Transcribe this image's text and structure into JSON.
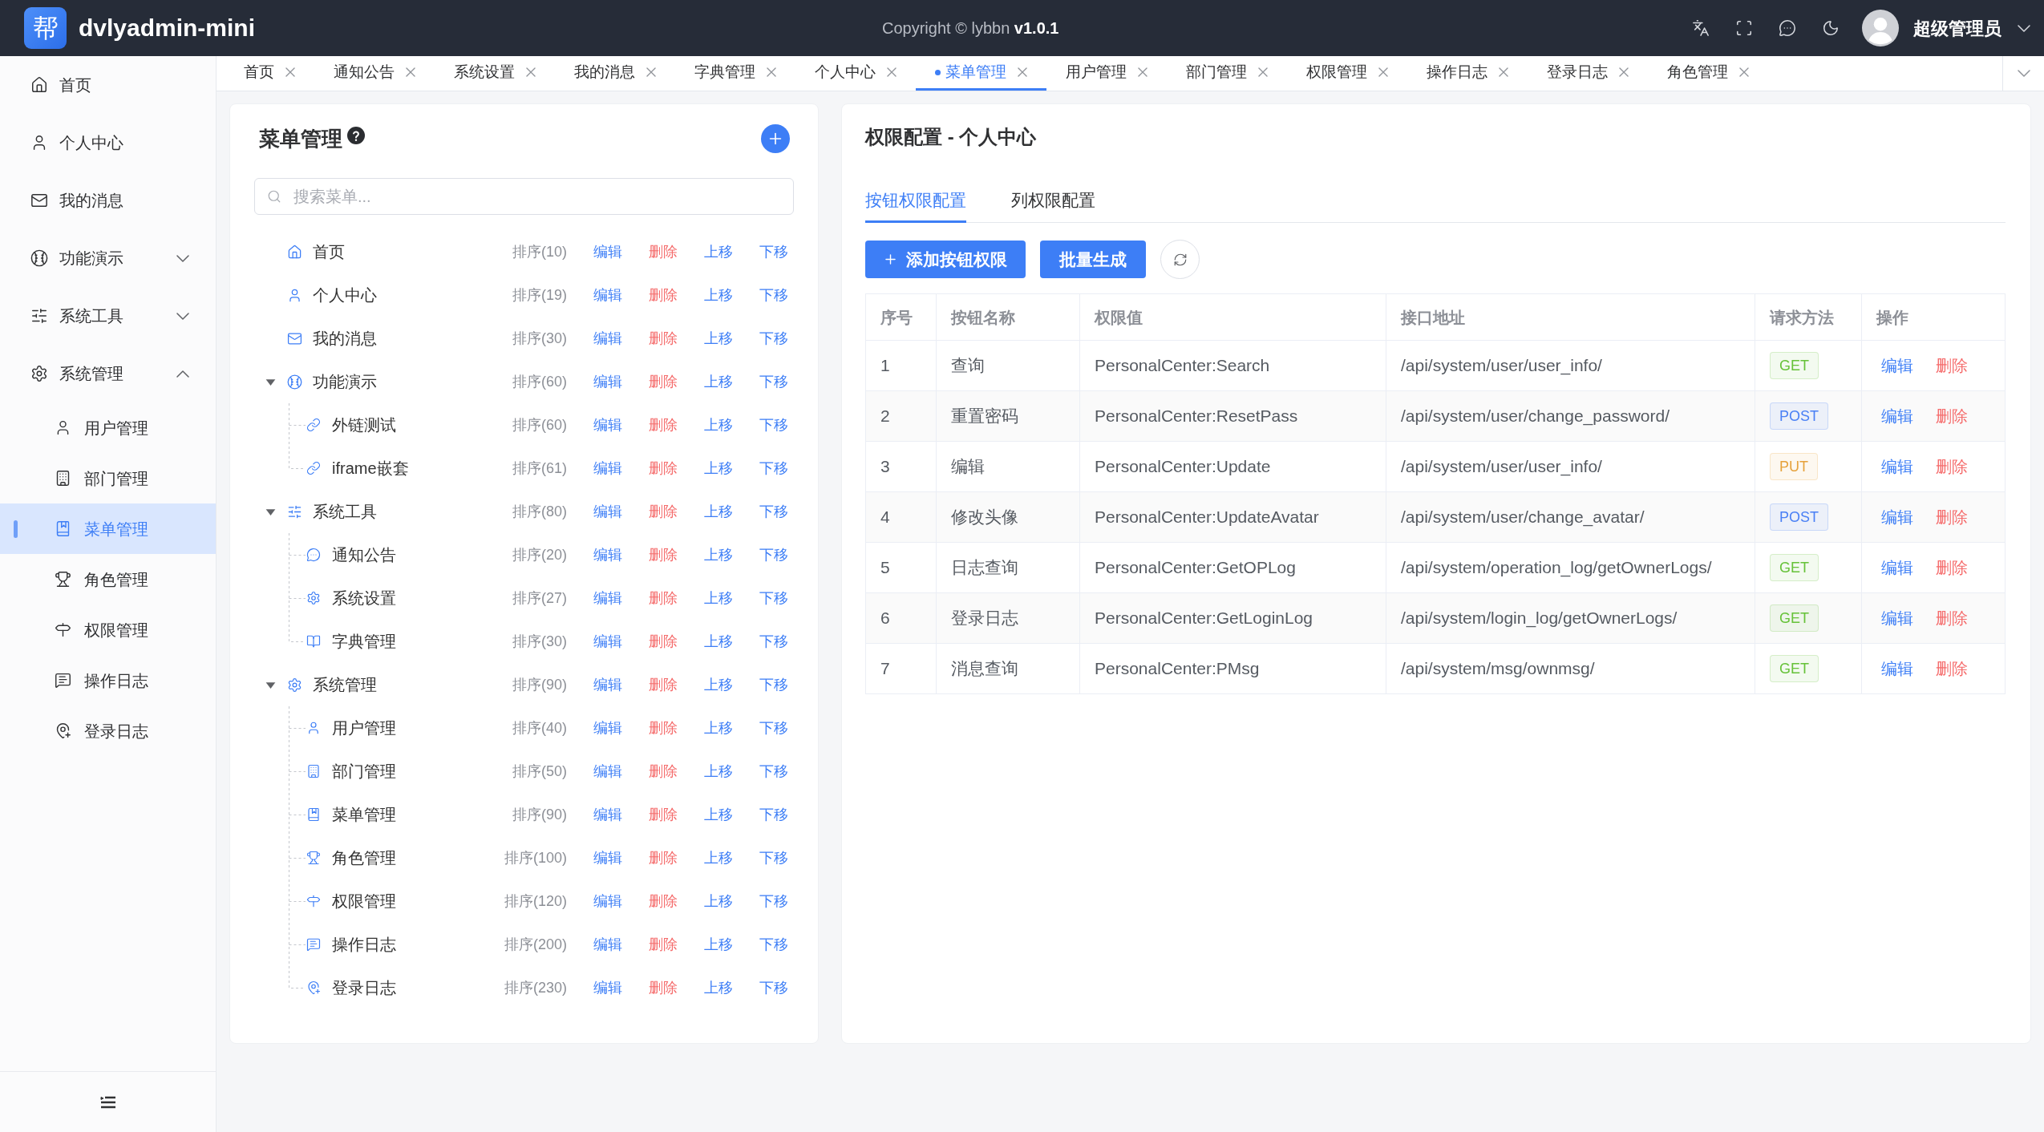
{
  "header": {
    "logo": "帮",
    "title": "dvlyadmin-mini",
    "copyright": "Copyright © lybbn **v1.0.1**",
    "user": "超级管理员"
  },
  "sidebar": {
    "items": [
      {
        "label": "首页",
        "selected": false
      },
      {
        "label": "个人中心",
        "selected": false
      },
      {
        "label": "我的消息",
        "selected": false
      },
      {
        "label": "功能演示",
        "selected": false,
        "expanded": false
      },
      {
        "label": "系统工具",
        "selected": false,
        "expanded": false
      },
      {
        "label": "系统管理",
        "selected": false,
        "expanded": true,
        "children": [
          {
            "label": "用户管理",
            "selected": false
          },
          {
            "label": "部门管理",
            "selected": false
          },
          {
            "label": "菜单管理",
            "selected": true
          },
          {
            "label": "角色管理",
            "selected": false
          },
          {
            "label": "权限管理",
            "selected": false
          },
          {
            "label": "操作日志",
            "selected": false
          },
          {
            "label": "登录日志",
            "selected": false
          }
        ]
      }
    ]
  },
  "tabs": [
    {
      "label": "首页",
      "selected": false
    },
    {
      "label": "通知公告",
      "selected": false
    },
    {
      "label": "系统设置",
      "selected": false
    },
    {
      "label": "我的消息",
      "selected": false
    },
    {
      "label": "字典管理",
      "selected": false
    },
    {
      "label": "个人中心",
      "selected": false
    },
    {
      "label": "菜单管理",
      "selected": true
    },
    {
      "label": "用户管理",
      "selected": false
    },
    {
      "label": "部门管理",
      "selected": false
    },
    {
      "label": "权限管理",
      "selected": false
    },
    {
      "label": "操作日志",
      "selected": false
    },
    {
      "label": "登录日志",
      "selected": false
    },
    {
      "label": "角色管理",
      "selected": false
    }
  ],
  "menu_panel": {
    "title": "菜单管理",
    "search": {
      "placeholder": "搜索菜单..."
    },
    "tree": [
      {
        "label": "首页",
        "sort": "排序(10)",
        "actions": [
          {
            "label": "编辑",
            "kind": "primary"
          },
          {
            "label": "删除",
            "kind": "danger"
          },
          {
            "label": "上移",
            "kind": "primary"
          },
          {
            "label": "下移",
            "kind": "primary"
          }
        ]
      },
      {
        "label": "个人中心",
        "sort": "排序(19)",
        "actions": [
          {
            "label": "编辑",
            "kind": "primary"
          },
          {
            "label": "删除",
            "kind": "danger"
          },
          {
            "label": "上移",
            "kind": "primary"
          },
          {
            "label": "下移",
            "kind": "primary"
          }
        ]
      },
      {
        "label": "我的消息",
        "sort": "排序(30)",
        "actions": [
          {
            "label": "编辑",
            "kind": "primary"
          },
          {
            "label": "删除",
            "kind": "danger"
          },
          {
            "label": "上移",
            "kind": "primary"
          },
          {
            "label": "下移",
            "kind": "primary"
          }
        ]
      },
      {
        "label": "功能演示",
        "sort": "排序(60)",
        "expanded": true,
        "actions": [
          {
            "label": "编辑",
            "kind": "primary"
          },
          {
            "label": "删除",
            "kind": "danger"
          },
          {
            "label": "上移",
            "kind": "primary"
          },
          {
            "label": "下移",
            "kind": "primary"
          }
        ],
        "children": [
          {
            "label": "外链测试",
            "sort": "排序(60)",
            "actions": [
              {
                "label": "编辑",
                "kind": "primary"
              },
              {
                "label": "删除",
                "kind": "danger"
              },
              {
                "label": "上移",
                "kind": "primary"
              },
              {
                "label": "下移",
                "kind": "primary"
              }
            ]
          },
          {
            "label": "iframe嵌套",
            "sort": "排序(61)",
            "actions": [
              {
                "label": "编辑",
                "kind": "primary"
              },
              {
                "label": "删除",
                "kind": "danger"
              },
              {
                "label": "上移",
                "kind": "primary"
              },
              {
                "label": "下移",
                "kind": "primary"
              }
            ]
          }
        ]
      },
      {
        "label": "系统工具",
        "sort": "排序(80)",
        "expanded": true,
        "actions": [
          {
            "label": "编辑",
            "kind": "primary"
          },
          {
            "label": "删除",
            "kind": "danger"
          },
          {
            "label": "上移",
            "kind": "primary"
          },
          {
            "label": "下移",
            "kind": "primary"
          }
        ],
        "children": [
          {
            "label": "通知公告",
            "sort": "排序(20)",
            "actions": [
              {
                "label": "编辑",
                "kind": "primary"
              },
              {
                "label": "删除",
                "kind": "danger"
              },
              {
                "label": "上移",
                "kind": "primary"
              },
              {
                "label": "下移",
                "kind": "primary"
              }
            ]
          },
          {
            "label": "系统设置",
            "sort": "排序(27)",
            "actions": [
              {
                "label": "编辑",
                "kind": "primary"
              },
              {
                "label": "删除",
                "kind": "danger"
              },
              {
                "label": "上移",
                "kind": "primary"
              },
              {
                "label": "下移",
                "kind": "primary"
              }
            ]
          },
          {
            "label": "字典管理",
            "sort": "排序(30)",
            "actions": [
              {
                "label": "编辑",
                "kind": "primary"
              },
              {
                "label": "删除",
                "kind": "danger"
              },
              {
                "label": "上移",
                "kind": "primary"
              },
              {
                "label": "下移",
                "kind": "primary"
              }
            ]
          }
        ]
      },
      {
        "label": "系统管理",
        "sort": "排序(90)",
        "expanded": true,
        "actions": [
          {
            "label": "编辑",
            "kind": "primary"
          },
          {
            "label": "删除",
            "kind": "danger"
          },
          {
            "label": "上移",
            "kind": "primary"
          },
          {
            "label": "下移",
            "kind": "primary"
          }
        ],
        "children": [
          {
            "label": "用户管理",
            "sort": "排序(40)",
            "actions": [
              {
                "label": "编辑",
                "kind": "primary"
              },
              {
                "label": "删除",
                "kind": "danger"
              },
              {
                "label": "上移",
                "kind": "primary"
              },
              {
                "label": "下移",
                "kind": "primary"
              }
            ]
          },
          {
            "label": "部门管理",
            "sort": "排序(50)",
            "actions": [
              {
                "label": "编辑",
                "kind": "primary"
              },
              {
                "label": "删除",
                "kind": "danger"
              },
              {
                "label": "上移",
                "kind": "primary"
              },
              {
                "label": "下移",
                "kind": "primary"
              }
            ]
          },
          {
            "label": "菜单管理",
            "sort": "排序(90)",
            "actions": [
              {
                "label": "编辑",
                "kind": "primary"
              },
              {
                "label": "删除",
                "kind": "danger"
              },
              {
                "label": "上移",
                "kind": "primary"
              },
              {
                "label": "下移",
                "kind": "primary"
              }
            ]
          },
          {
            "label": "角色管理",
            "sort": "排序(100)",
            "actions": [
              {
                "label": "编辑",
                "kind": "primary"
              },
              {
                "label": "删除",
                "kind": "danger"
              },
              {
                "label": "上移",
                "kind": "primary"
              },
              {
                "label": "下移",
                "kind": "primary"
              }
            ]
          },
          {
            "label": "权限管理",
            "sort": "排序(120)",
            "actions": [
              {
                "label": "编辑",
                "kind": "primary"
              },
              {
                "label": "删除",
                "kind": "danger"
              },
              {
                "label": "上移",
                "kind": "primary"
              },
              {
                "label": "下移",
                "kind": "primary"
              }
            ]
          },
          {
            "label": "操作日志",
            "sort": "排序(200)",
            "actions": [
              {
                "label": "编辑",
                "kind": "primary"
              },
              {
                "label": "删除",
                "kind": "danger"
              },
              {
                "label": "上移",
                "kind": "primary"
              },
              {
                "label": "下移",
                "kind": "primary"
              }
            ]
          },
          {
            "label": "登录日志",
            "sort": "排序(230)",
            "actions": [
              {
                "label": "编辑",
                "kind": "primary"
              },
              {
                "label": "删除",
                "kind": "danger"
              },
              {
                "label": "上移",
                "kind": "primary"
              },
              {
                "label": "下移",
                "kind": "primary"
              }
            ]
          }
        ]
      }
    ]
  },
  "permission_panel": {
    "title": "权限配置 - 个人中心",
    "tabs": [
      {
        "label": "按钮权限配置",
        "selected": true
      },
      {
        "label": "列权限配置",
        "selected": false
      }
    ],
    "buttons": [
      {
        "label": "添加按钮权限",
        "kind": "add"
      },
      {
        "label": "批量生成",
        "kind": "primary"
      }
    ],
    "table": {
      "columns": [
        "序号",
        "按钮名称",
        "权限值",
        "接口地址",
        "请求方法",
        "操作"
      ],
      "rows": [
        {
          "cells": [
            "1",
            "查询",
            "PersonalCenter:Search",
            "/api/system/user/user_info/"
          ],
          "method": {
            "label": "GET",
            "color": "#67c23a"
          },
          "actions": [
            {
              "label": "编辑",
              "kind": "primary"
            },
            {
              "label": "删除",
              "kind": "danger"
            }
          ]
        },
        {
          "cells": [
            "2",
            "重置密码",
            "PersonalCenter:ResetPass",
            "/api/system/user/change_password/"
          ],
          "method": {
            "label": "POST",
            "color": "#4a80f5"
          },
          "actions": [
            {
              "label": "编辑",
              "kind": "primary"
            },
            {
              "label": "删除",
              "kind": "danger"
            }
          ]
        },
        {
          "cells": [
            "3",
            "编辑",
            "PersonalCenter:Update",
            "/api/system/user/user_info/"
          ],
          "method": {
            "label": "PUT",
            "color": "#e6a23c"
          },
          "actions": [
            {
              "label": "编辑",
              "kind": "primary"
            },
            {
              "label": "删除",
              "kind": "danger"
            }
          ]
        },
        {
          "cells": [
            "4",
            "修改头像",
            "PersonalCenter:UpdateAvatar",
            "/api/system/user/change_avatar/"
          ],
          "method": {
            "label": "POST",
            "color": "#4a80f5"
          },
          "actions": [
            {
              "label": "编辑",
              "kind": "primary"
            },
            {
              "label": "删除",
              "kind": "danger"
            }
          ]
        },
        {
          "cells": [
            "5",
            "日志查询",
            "PersonalCenter:GetOPLog",
            "/api/system/operation_log/getOwnerLogs/"
          ],
          "method": {
            "label": "GET",
            "color": "#67c23a"
          },
          "actions": [
            {
              "label": "编辑",
              "kind": "primary"
            },
            {
              "label": "删除",
              "kind": "danger"
            }
          ]
        },
        {
          "cells": [
            "6",
            "登录日志",
            "PersonalCenter:GetLoginLog",
            "/api/system/login_log/getOwnerLogs/"
          ],
          "method": {
            "label": "GET",
            "color": "#67c23a"
          },
          "actions": [
            {
              "label": "编辑",
              "kind": "primary"
            },
            {
              "label": "删除",
              "kind": "danger"
            }
          ]
        },
        {
          "cells": [
            "7",
            "消息查询",
            "PersonalCenter:PMsg",
            "/api/system/msg/ownmsg/"
          ],
          "method": {
            "label": "GET",
            "color": "#67c23a"
          },
          "actions": [
            {
              "label": "编辑",
              "kind": "primary"
            },
            {
              "label": "删除",
              "kind": "danger"
            }
          ]
        }
      ]
    }
  }
}
